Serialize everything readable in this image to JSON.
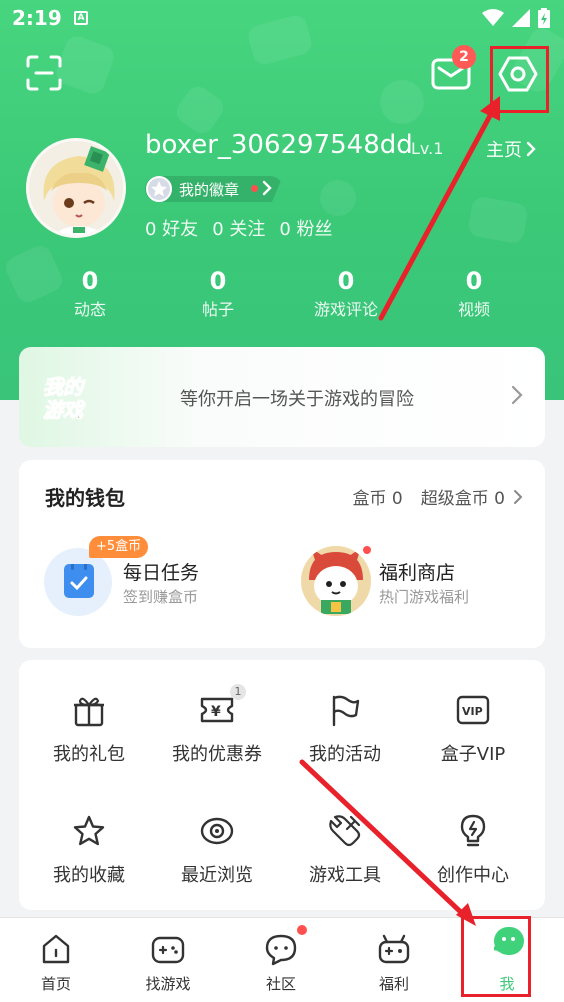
{
  "status_bar": {
    "time": "2:19",
    "notif_letter": "A"
  },
  "header": {
    "mail_badge_count": "2",
    "username": "boxer_306297548dd",
    "level": "Lv.1",
    "homepage_label": "主页",
    "badge_label": "我的徽章",
    "social": {
      "friends": "0 好友",
      "following": "0 关注",
      "fans": "0 粉丝"
    },
    "stats": [
      {
        "value": "0",
        "label": "动态"
      },
      {
        "value": "0",
        "label": "帖子"
      },
      {
        "value": "0",
        "label": "游戏评论"
      },
      {
        "value": "0",
        "label": "视频"
      }
    ]
  },
  "adventure_card": {
    "logo_line1": "我的",
    "logo_line2": "游戏",
    "text": "等你开启一场关于游戏的冒险"
  },
  "wallet": {
    "title": "我的钱包",
    "coins": "盒币 0",
    "super_coins": "超级盒币 0",
    "daily_task": {
      "badge": "+5盒币",
      "title": "每日任务",
      "subtitle": "签到赚盒币"
    },
    "welfare_shop": {
      "title": "福利商店",
      "subtitle": "热门游戏福利"
    }
  },
  "grid": {
    "items": [
      {
        "label": "我的礼包",
        "icon": "gift-icon"
      },
      {
        "label": "我的优惠券",
        "icon": "coupon-icon",
        "count": "1"
      },
      {
        "label": "我的活动",
        "icon": "flag-icon"
      },
      {
        "label": "盒子VIP",
        "icon": "vip-icon",
        "icon_text": "VIP"
      },
      {
        "label": "我的收藏",
        "icon": "star-icon"
      },
      {
        "label": "最近浏览",
        "icon": "eye-icon"
      },
      {
        "label": "游戏工具",
        "icon": "tools-icon"
      },
      {
        "label": "创作中心",
        "icon": "lightbulb-icon"
      }
    ]
  },
  "bottom_nav": {
    "items": [
      {
        "label": "首页",
        "icon": "home-icon"
      },
      {
        "label": "找游戏",
        "icon": "gamepad-icon"
      },
      {
        "label": "社区",
        "icon": "chat-icon"
      },
      {
        "label": "福利",
        "icon": "gift-box-icon"
      },
      {
        "label": "我",
        "icon": "me-icon",
        "active": true
      }
    ]
  },
  "colors": {
    "brand_green": "#3ec97a",
    "annotation_red": "#e8212b",
    "badge_red": "#ff5a55",
    "orange": "#ff8d3a",
    "task_blue": "#3d8eef"
  }
}
